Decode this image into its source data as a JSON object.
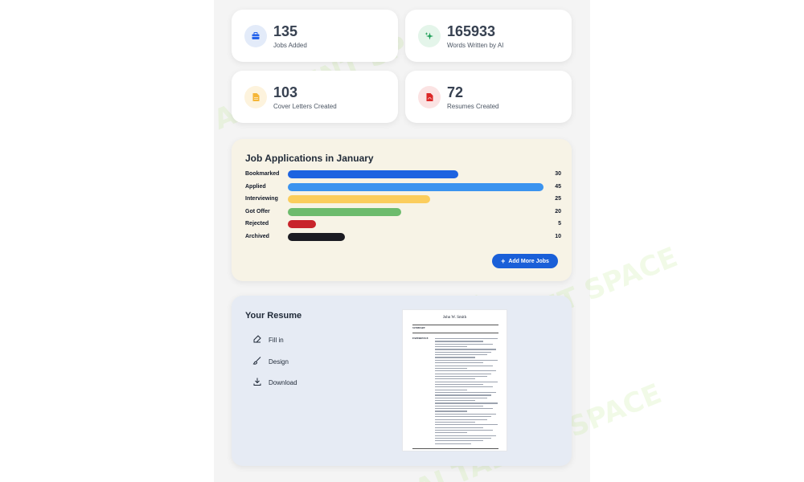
{
  "watermark_text": "AI TALENT SPACE",
  "stats": [
    {
      "value": "135",
      "label": "Jobs Added",
      "icon": "briefcase-icon",
      "color": "#2563eb",
      "bg": "#e3ebf9"
    },
    {
      "value": "165933",
      "label": "Words Written by AI",
      "icon": "sparkles-icon",
      "color": "#22a05a",
      "bg": "#e4f5ea"
    },
    {
      "value": "103",
      "label": "Cover Letters Created",
      "icon": "document-icon",
      "color": "#f5b638",
      "bg": "#fdf3dd"
    },
    {
      "value": "72",
      "label": "Resumes Created",
      "icon": "pdf-icon",
      "color": "#dc2626",
      "bg": "#fbe3e3"
    }
  ],
  "chart_data": {
    "type": "bar",
    "title": "Job Applications in January",
    "categories": [
      "Bookmarked",
      "Applied",
      "Interviewing",
      "Got Offer",
      "Rejected",
      "Archived"
    ],
    "values": [
      30,
      45,
      25,
      20,
      5,
      10
    ],
    "colors": [
      "#1d63e0",
      "#3b93ef",
      "#fbcd5d",
      "#6dbb6d",
      "#c8242b",
      "#1b1b22"
    ],
    "xlim": [
      0,
      45
    ]
  },
  "chart_actions": {
    "add_more_jobs": "Add More Jobs"
  },
  "resume": {
    "title": "Your Resume",
    "actions": [
      {
        "label": "Fill in",
        "icon": "pencil-icon"
      },
      {
        "label": "Design",
        "icon": "brush-icon"
      },
      {
        "label": "Download",
        "icon": "download-icon"
      }
    ],
    "preview": {
      "name": "John W. Smith",
      "sections": [
        "SUMMARY",
        "EXPERIENCE"
      ]
    }
  }
}
